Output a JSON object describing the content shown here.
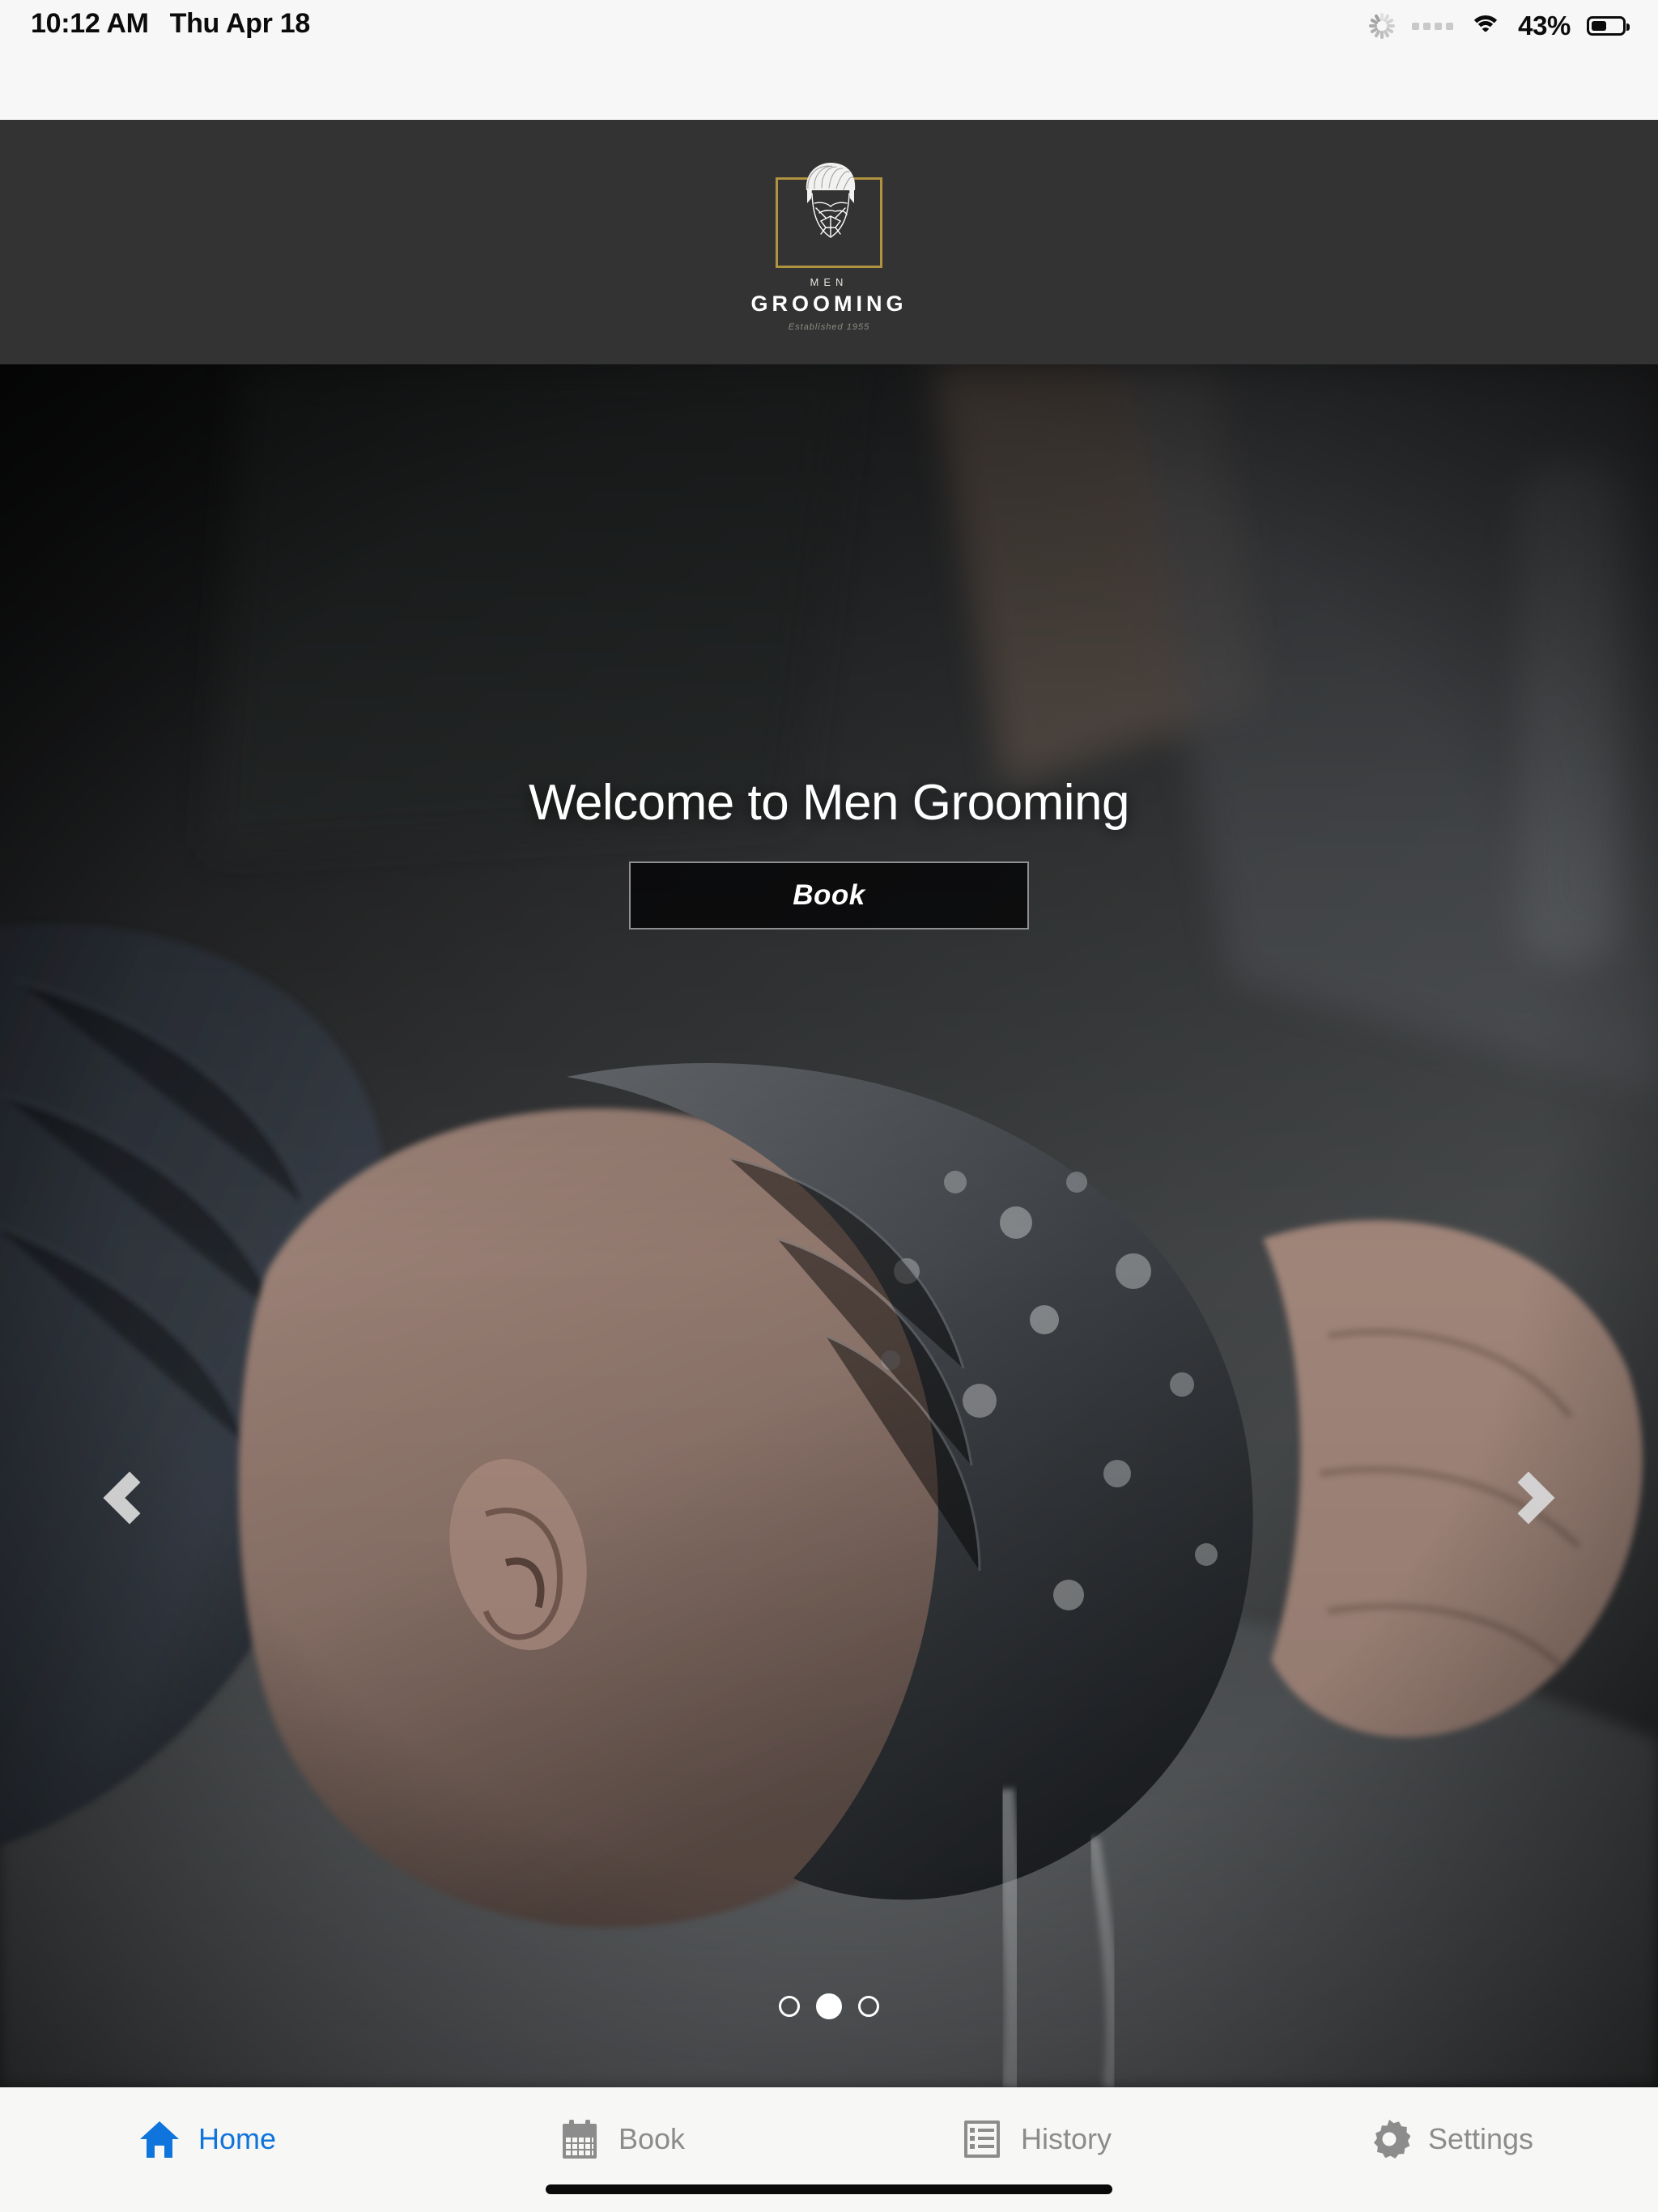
{
  "status_bar": {
    "time": "10:12 AM",
    "date": "Thu Apr 18",
    "battery_percent": "43%",
    "battery_level": 43,
    "icons": [
      "activity-spinner-icon",
      "signal-dots-icon",
      "wifi-icon",
      "battery-icon"
    ]
  },
  "header": {
    "logo": {
      "word_top": "MEN",
      "word_main": "GROOMING",
      "tagline": "Established 1955",
      "frame_color": "#b0933f",
      "background": "#333333",
      "mark": "bearded-man-face-icon"
    }
  },
  "hero": {
    "title": "Welcome to Men Grooming",
    "book_button": "Book",
    "prev_arrow": "chevron-left-icon",
    "next_arrow": "chevron-right-icon",
    "image_description": "man having his hair washed at a barbershop",
    "carousel": {
      "total_slides": 3,
      "active_index": 1
    }
  },
  "tabbar": {
    "active_index": 0,
    "accent_color": "#1074dd",
    "inactive_color": "#8c8c8c",
    "items": [
      {
        "label": "Home",
        "icon": "home-icon"
      },
      {
        "label": "Book",
        "icon": "calendar-icon"
      },
      {
        "label": "History",
        "icon": "list-icon"
      },
      {
        "label": "Settings",
        "icon": "gear-icon"
      }
    ]
  }
}
